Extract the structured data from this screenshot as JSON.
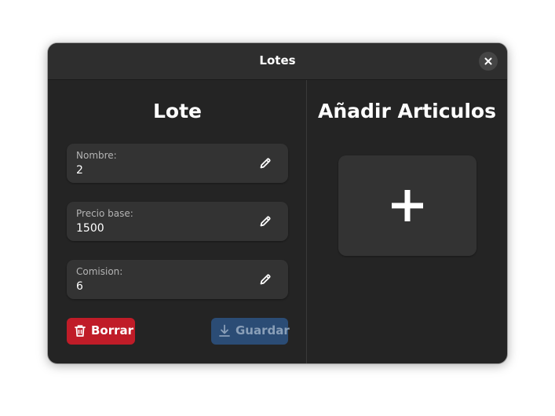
{
  "window": {
    "title": "Lotes",
    "close_icon": "close-icon"
  },
  "left_panel": {
    "heading": "Lote",
    "fields": [
      {
        "label": "Nombre:",
        "value": "2",
        "icon": "pencil-icon"
      },
      {
        "label": "Precio base:",
        "value": "1500",
        "icon": "pencil-icon"
      },
      {
        "label": "Comision:",
        "value": "6",
        "icon": "pencil-icon"
      }
    ],
    "delete_button": {
      "label": "Borrar",
      "icon": "trash-icon",
      "color": "#c01c28"
    },
    "save_button": {
      "label": "Guardar",
      "icon": "download-icon",
      "color": "#2b4c75",
      "enabled": false
    }
  },
  "right_panel": {
    "heading": "Añadir Articulos",
    "add_icon": "plus-icon"
  },
  "colors": {
    "window_bg": "#242424",
    "titlebar_bg": "#2e2e2e",
    "field_bg": "#333333"
  }
}
